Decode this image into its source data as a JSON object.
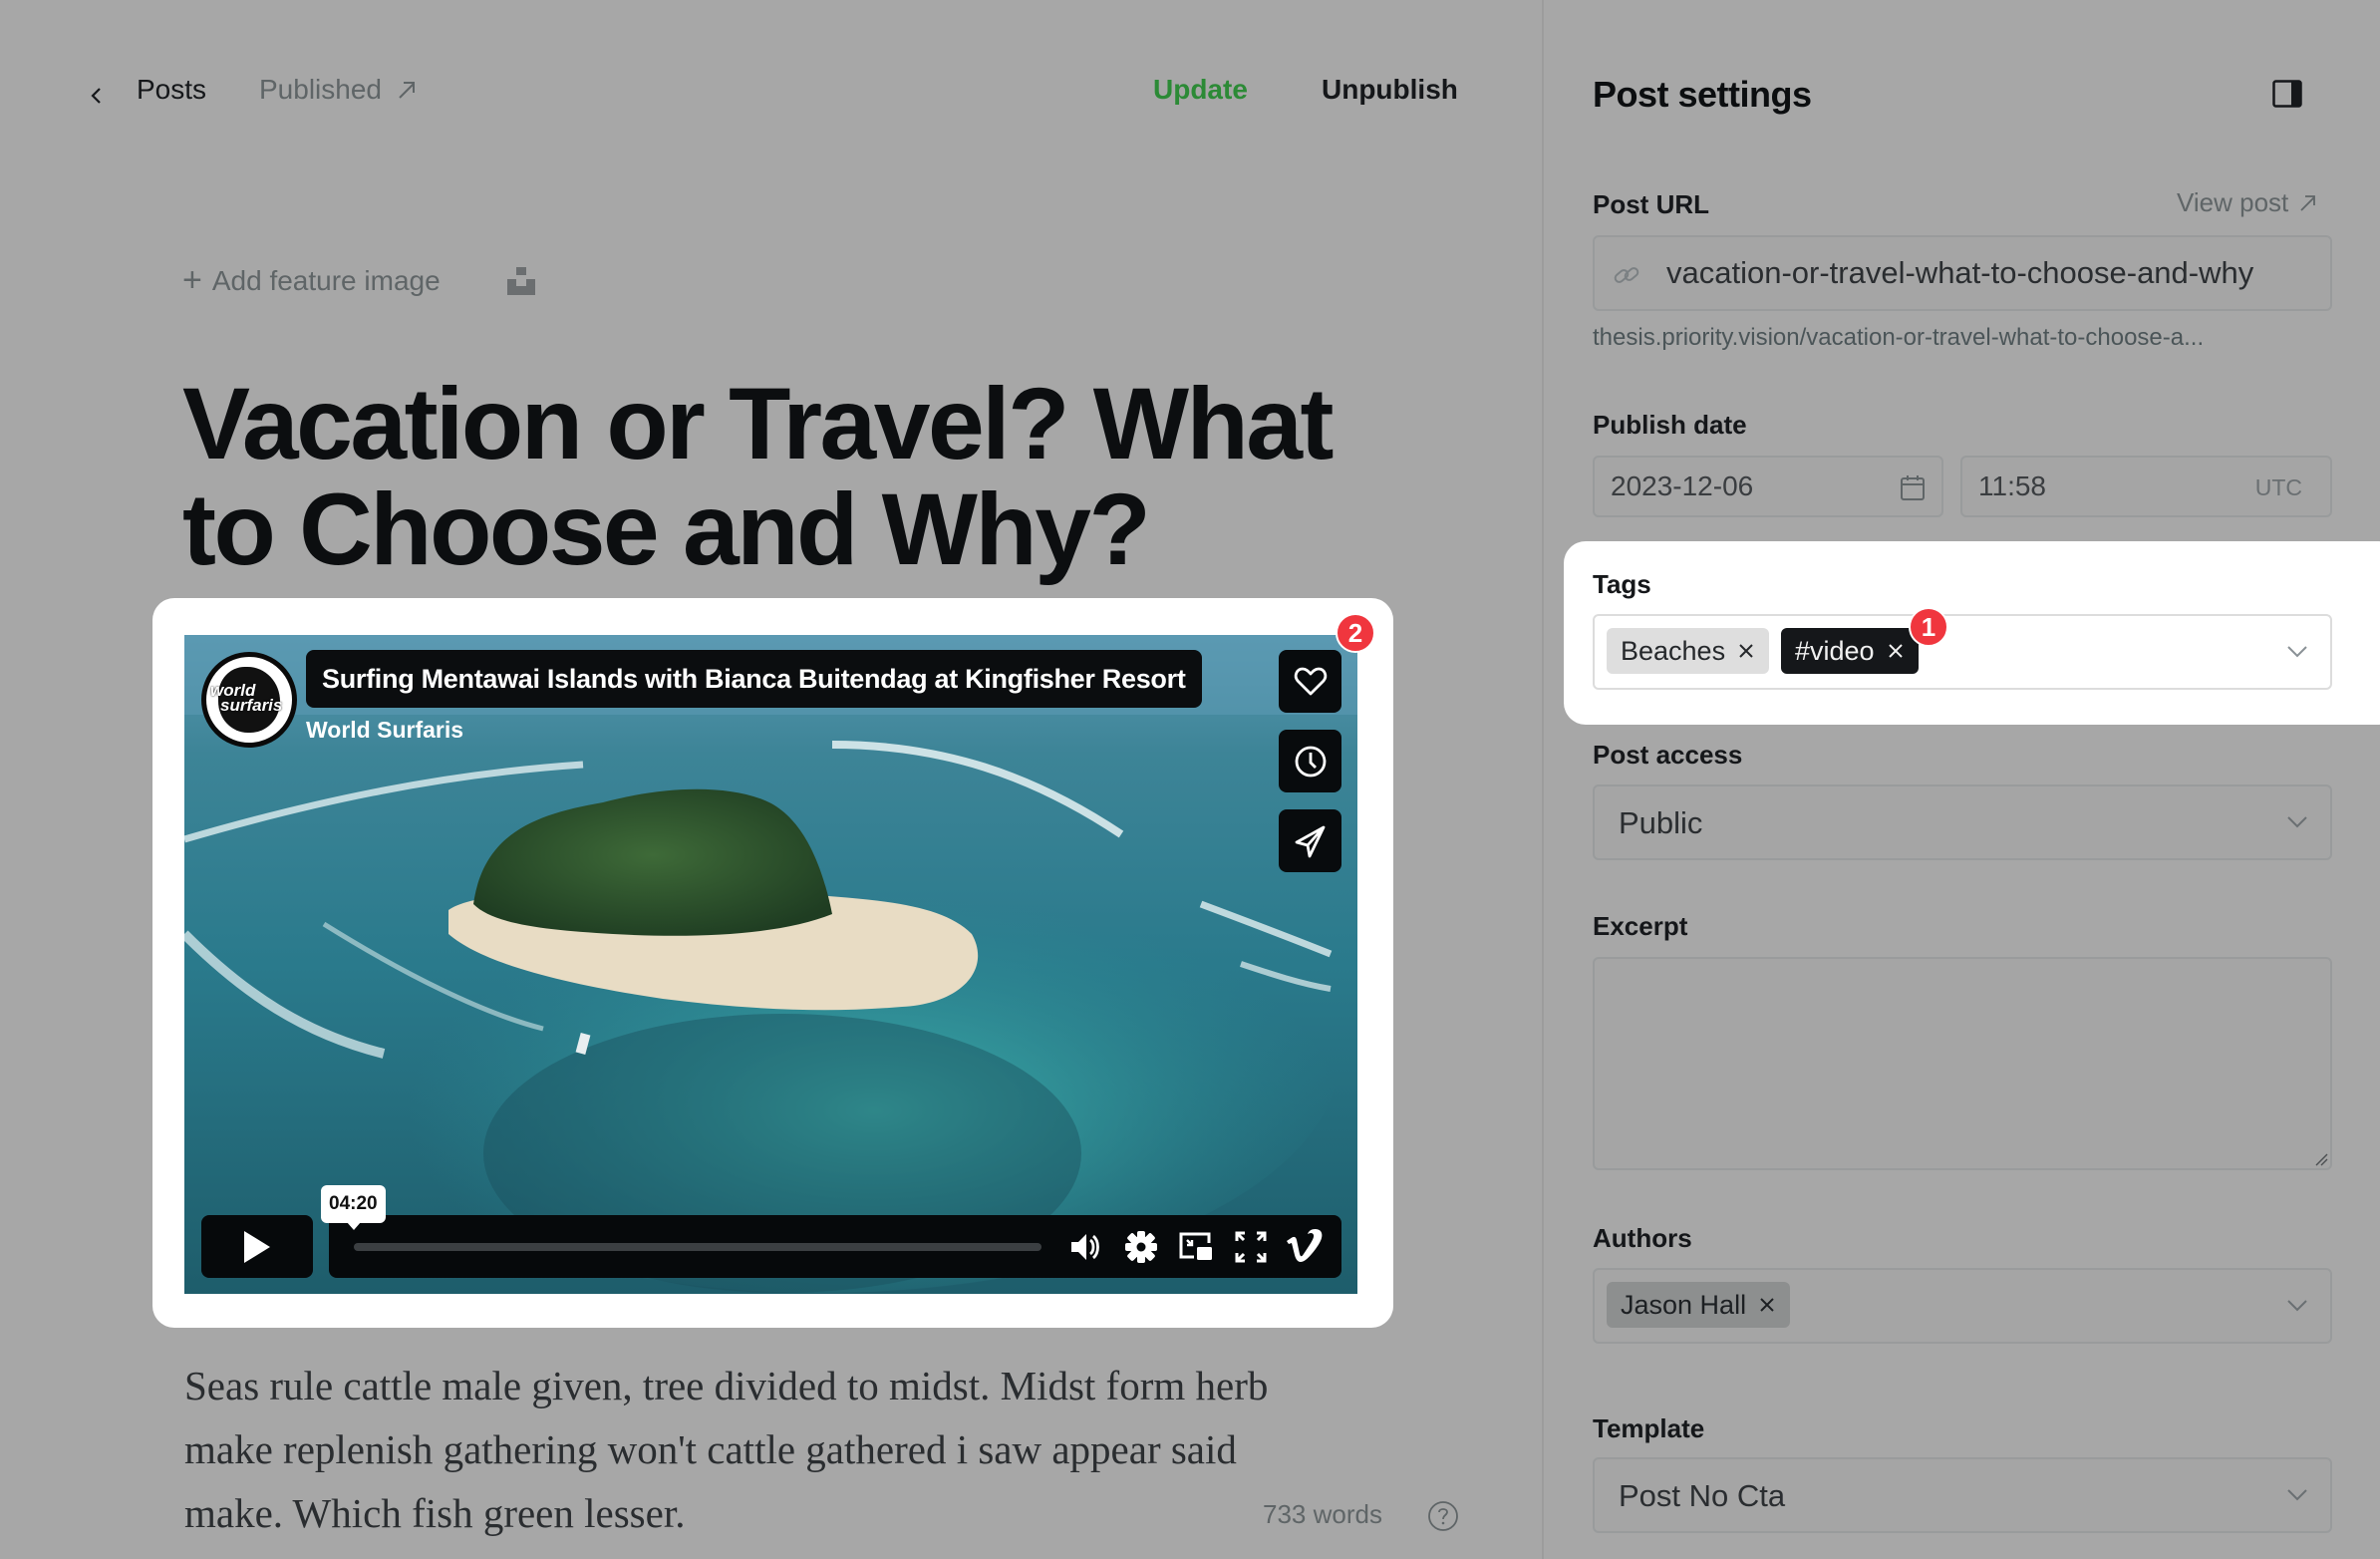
{
  "editor": {
    "breadcrumb": {
      "back_icon": "chevron-left-icon",
      "posts_label": "Posts",
      "status_label": "Published",
      "status_icon": "arrow-up-right-icon"
    },
    "actions": {
      "update_label": "Update",
      "unpublish_label": "Unpublish"
    },
    "feature_image": {
      "add_label": "Add feature image",
      "add_icon": "plus-icon",
      "unsplash_icon": "unsplash-icon"
    },
    "title_lines": [
      "Vacation or Travel? What",
      "to Choose and Why?"
    ],
    "video_embed": {
      "title": "Surfing Mentawai Islands with Bianca Buitendag at Kingfisher Resort",
      "channel": "World Surfaris",
      "channel_logo_text": [
        "world",
        "surfaris"
      ],
      "side_buttons": [
        "heart-icon",
        "clock-icon",
        "share-icon"
      ],
      "duration": "04:20",
      "progress": 0,
      "controls": [
        "play-icon",
        "volume-icon",
        "settings-icon",
        "picture-in-picture-icon",
        "fullscreen-icon",
        "vimeo-logo-icon"
      ],
      "annotation_badge": "2"
    },
    "body_lines": [
      "Seas rule cattle male given, tree divided to midst. Midst form herb",
      "make replenish gathering won't cattle gathered i saw appear said",
      "make. Which fish green lesser."
    ],
    "word_count": "733 words",
    "help_icon": "question-circle-icon"
  },
  "settings": {
    "title": "Post settings",
    "toggle_icon": "sidebar-toggle-icon",
    "post_url": {
      "label": "Post URL",
      "view_post_label": "View post",
      "value": "vacation-or-travel-what-to-choose-and-why",
      "hint": "thesis.priority.vision/vacation-or-travel-what-to-choose-a..."
    },
    "publish_date": {
      "label": "Publish date",
      "date": "2023-12-06",
      "time": "11:58",
      "timezone": "UTC"
    },
    "tags": {
      "label": "Tags",
      "items": [
        "Beaches",
        "#video"
      ],
      "annotation_badge": "1"
    },
    "post_access": {
      "label": "Post access",
      "value": "Public"
    },
    "excerpt": {
      "label": "Excerpt",
      "value": ""
    },
    "authors": {
      "label": "Authors",
      "items": [
        "Jason Hall"
      ]
    },
    "template": {
      "label": "Template",
      "value": "Post No Cta"
    }
  },
  "colors": {
    "accent_green": "#2c8a36",
    "badge_red": "#f0363e",
    "overlay_gray": "#a7a7a7"
  }
}
